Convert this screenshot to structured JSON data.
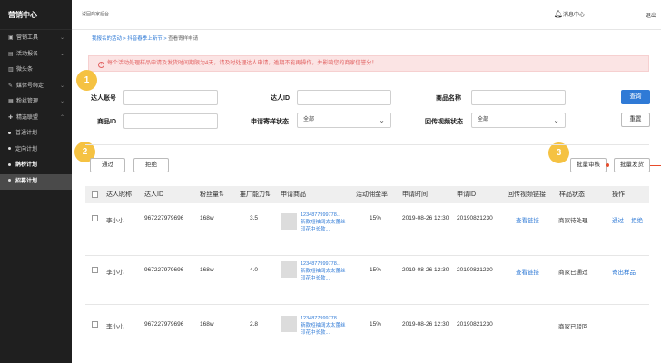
{
  "sidebar": {
    "title": "营销中心",
    "items": [
      {
        "icon": "▣",
        "label": "营销工具",
        "chevron": "⌄"
      },
      {
        "icon": "▤",
        "label": "活动报名",
        "chevron": "⌄"
      },
      {
        "icon": "▥",
        "label": "微头条",
        "chevron": ""
      },
      {
        "icon": "✎",
        "label": "媒体号绑定",
        "chevron": "⌄"
      },
      {
        "icon": "▦",
        "label": "粉丝管理",
        "chevron": "⌄"
      },
      {
        "icon": "✚",
        "label": "精选联盟",
        "chevron": "⌃"
      }
    ],
    "subitems": [
      {
        "label": "普通计划"
      },
      {
        "label": "定向计划"
      },
      {
        "label": "鹊桥计划"
      },
      {
        "label": "招募计划"
      }
    ]
  },
  "topbar": {
    "back": "返回商家后台",
    "message": "消息中心",
    "logout": "退出"
  },
  "breadcrumb": {
    "part1": "我报名的活动",
    "sep1": " > ",
    "part2": "抖音春季上新节",
    "sep2": " > ",
    "current": "查看寄样申请"
  },
  "alert": {
    "icon": "!",
    "text": "每个活动处理样品申请及发货时间期限为4天，请及时处理达人申请，逾期不能再操作，并影响您的商家信誉分！"
  },
  "markers": [
    "1",
    "2",
    "3"
  ],
  "filters": {
    "talent_account": "达人账号",
    "talent_id": "达人ID",
    "product_name": "商品名称",
    "product_id": "商品ID",
    "sample_status": "申请寄样状态",
    "sample_status_value": "全部",
    "video_status": "回传视频状态",
    "video_status_value": "全部",
    "search_button": "查询",
    "reset_button": "重置"
  },
  "actions": {
    "pass": "通过",
    "reject": "拒绝",
    "batch_review": "批量审核",
    "batch_ship": "批量发货"
  },
  "table": {
    "headers": [
      "达人昵称",
      "达人ID",
      "粉丝量",
      "推广能力",
      "申请商品",
      "活动佣金率",
      "申请时间",
      "申请ID",
      "回传视频链接",
      "样品状态",
      "操作"
    ],
    "sort_icon": "⇅",
    "rows": [
      {
        "nickname": "李小小",
        "talent_id": "967227979696",
        "fans": "168w",
        "ability": "3.5",
        "product_line1": "1234877999778...",
        "product_line2": "新款短袖阔太太蕾丝",
        "product_line3": "印花中长款...",
        "commission": "15%",
        "time": "2019-08-26 12:30",
        "apply_id": "20190821230",
        "video_link": "查看链接",
        "status": "商家待处理",
        "op1": "通过",
        "op2": "拒绝"
      },
      {
        "nickname": "李小小",
        "talent_id": "967227979696",
        "fans": "168w",
        "ability": "4.0",
        "product_line1": "1234877999778...",
        "product_line2": "新款短袖阔太太蕾丝",
        "product_line3": "印花中长款...",
        "commission": "15%",
        "time": "2019-08-26 12:30",
        "apply_id": "20190821230",
        "video_link": "查看链接",
        "status": "商家已通过",
        "op1": "寄出样品",
        "op2": ""
      },
      {
        "nickname": "李小小",
        "talent_id": "967227979696",
        "fans": "168w",
        "ability": "2.8",
        "product_line1": "1234877999778...",
        "product_line2": "新款短袖阔太太蕾丝",
        "product_line3": "印花中长款...",
        "commission": "15%",
        "time": "2019-08-26 12:30",
        "apply_id": "20190821230",
        "video_link": "",
        "status": "商家已驳回",
        "op1": "",
        "op2": ""
      }
    ]
  },
  "colors": {
    "sidebar_bg": "#1f1f1f",
    "primary": "#2f7ad6",
    "alert_bg": "#fbe4e4",
    "alert_text": "#e26363",
    "marker": "#f5c242",
    "annotation_red": "#e84c2b"
  }
}
